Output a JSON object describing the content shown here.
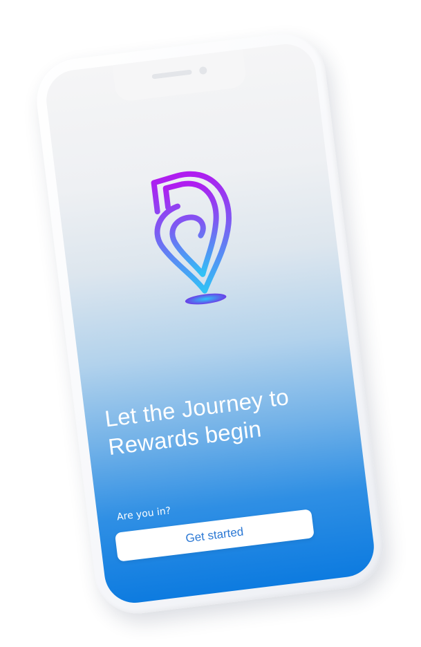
{
  "screen": {
    "headline": "Let the Journey to Rewards begin",
    "subline": "Are you in?",
    "cta_label": "Get started"
  },
  "colors": {
    "gradient_top": "#f5f5f6",
    "gradient_bottom": "#0d7be0",
    "logo_top": "#b01cf0",
    "logo_bottom": "#2fc2f6",
    "button_text": "#2b78d4"
  },
  "icons": {
    "logo": "location-pin-spiral-logo"
  }
}
